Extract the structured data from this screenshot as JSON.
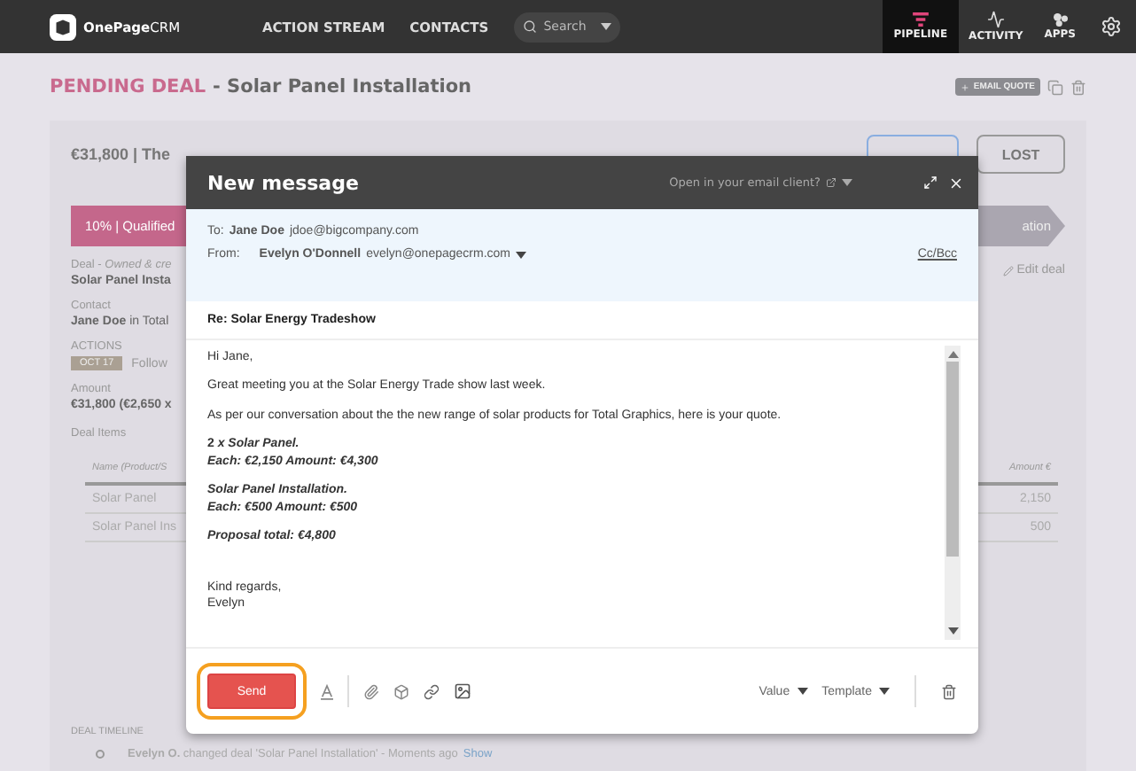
{
  "header": {
    "logo": "**OnePage**CRM",
    "nav": [
      {
        "label": "ACTION STREAM"
      },
      {
        "label": "CONTACTS"
      }
    ],
    "search": {
      "placeholder": "Search"
    },
    "tabs": [
      {
        "label": "PIPELINE",
        "kind": "pipeline",
        "selected": true
      },
      {
        "label": "ACTIVITY",
        "kind": "activity",
        "selected": false
      },
      {
        "label": "APPS",
        "kind": "apps",
        "selected": false
      }
    ]
  },
  "deal": {
    "status": "PENDING DEAL",
    "title": "- Solar Panel Installation",
    "email_quote": "EMAIL QUOTE",
    "summary": "€31,800 | The",
    "lost_button": "LOST",
    "stages": [
      {
        "label": "10% | Qualified",
        "selected": true
      },
      {
        "label": "ation",
        "selected": false
      }
    ],
    "edit": "Edit deal",
    "fields": [
      {
        "label": "Deal - *Owned & cre*",
        "value": "Solar Panel Insta"
      },
      {
        "label": "Contact",
        "value": "**Jane Doe** in Total"
      }
    ],
    "actions": {
      "label": "ACTIONS",
      "date": "OCT 17",
      "text": "Follow"
    },
    "amount": {
      "label": "Amount",
      "value": "€31,800 (€2,650 x"
    },
    "items": {
      "label": "Deal Items",
      "columns": [
        "Name (Product/S",
        "Amount €"
      ],
      "rows": [
        [
          "Solar Panel",
          "2,150"
        ],
        [
          "Solar Panel Ins",
          "500"
        ]
      ]
    },
    "timeline": {
      "label": "DEAL TIMELINE",
      "entry": "**Evelyn O.** changed deal 'Solar Panel Installation' - Moments ago",
      "link": "Show"
    }
  },
  "message": {
    "title": "New message",
    "open_client": "Open in your email client?",
    "to_label": "To:",
    "to_name": "Jane Doe",
    "to_email": "jdoe@bigcompany.com",
    "from_label": "From:",
    "from_name": "Evelyn O'Donnell",
    "from_email": "evelyn@onepagecrm.com",
    "cc": "Cc/Bcc",
    "subject": "Re: Solar Energy Tradeshow",
    "body": [
      {
        "kind": "plain",
        "lines": [
          "Hi Jane,"
        ]
      },
      {
        "kind": "plain",
        "lines": [
          "Great meeting you at the Solar Energy Trade show last week."
        ]
      },
      {
        "kind": "plain",
        "lines": [
          "As per our conversation about the the new range of solar products for Total Graphics, here is your quote."
        ]
      },
      {
        "kind": "emphasis",
        "lines": [
          "2 *x Solar Panel.*",
          "*Each: €2,150  Amount: €4,300*"
        ]
      },
      {
        "kind": "emphasis",
        "lines": [
          "*Solar Panel Installation.*",
          "*Each: €500  Amount: €500*"
        ]
      },
      {
        "kind": "emphasis",
        "lines": [
          "*Proposal total: €4,800*"
        ]
      },
      {
        "kind": "closing",
        "lines": [
          "Kind regards,",
          "Evelyn"
        ]
      }
    ],
    "send": "Send",
    "menus": [
      {
        "label": "Value"
      },
      {
        "label": "Template"
      }
    ]
  }
}
